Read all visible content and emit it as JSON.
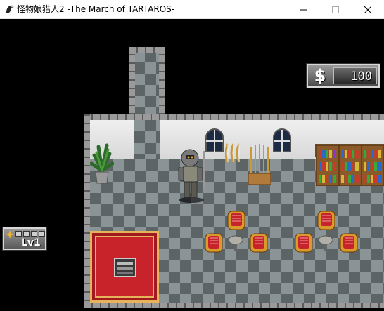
{
  "window": {
    "title": "怪物娘猎人2 -The March of TARTAROS-",
    "buttons": {
      "minimize": "minimize-icon",
      "maximize": "maximize-icon",
      "close": "close-icon"
    }
  },
  "hud": {
    "money": {
      "symbol": "$",
      "value": "100"
    },
    "level": {
      "label": "Lv1"
    }
  },
  "scene": {
    "location": "armory interior",
    "objects": [
      "corridor",
      "potted-plant",
      "arched-window",
      "arched-window",
      "bow-rack",
      "spear-rack",
      "bookshelf",
      "bookshelf",
      "bookshelf",
      "red-carpet",
      "stair-hatch",
      "armchair",
      "armchair",
      "armchair",
      "armchair",
      "armchair",
      "armchair",
      "round-table",
      "round-table"
    ],
    "player": "armored-hero"
  },
  "colors": {
    "floor_light": "#8a9497",
    "floor_dark": "#5c6466",
    "carpet": "#c8222a",
    "carpet_trim": "#e6b35a",
    "wall": "#efefef",
    "chair": "#c8222a"
  }
}
